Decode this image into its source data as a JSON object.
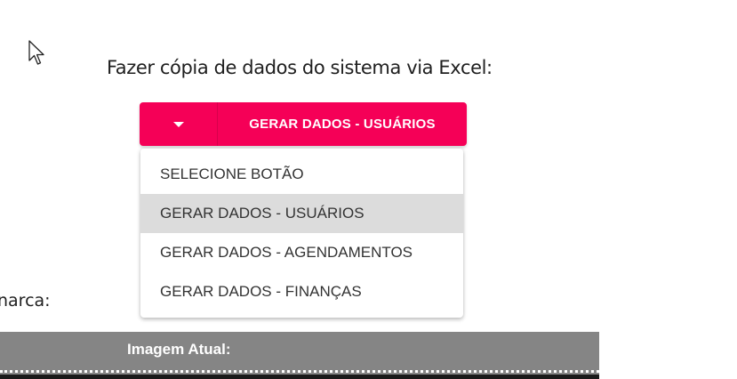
{
  "heading": "Fazer cópia de dados do sistema via Excel:",
  "split_button": {
    "toggle_icon": "arrow-drop-down-icon",
    "label": "GERAR DADOS - USUÁRIOS",
    "color": "#f50057"
  },
  "menu": {
    "items": [
      {
        "label": "SELECIONE BOTÃO",
        "selected": false
      },
      {
        "label": "GERAR DADOS - USUÁRIOS",
        "selected": true
      },
      {
        "label": "GERAR DADOS - AGENDAMENTOS",
        "selected": false
      },
      {
        "label": "GERAR DADOS - FINANÇAS",
        "selected": false
      }
    ]
  },
  "side_label": "narca:",
  "image_section": {
    "title": "Imagem Atual:",
    "header_color": "#858585"
  },
  "cursor_icon": "mouse-pointer-icon"
}
